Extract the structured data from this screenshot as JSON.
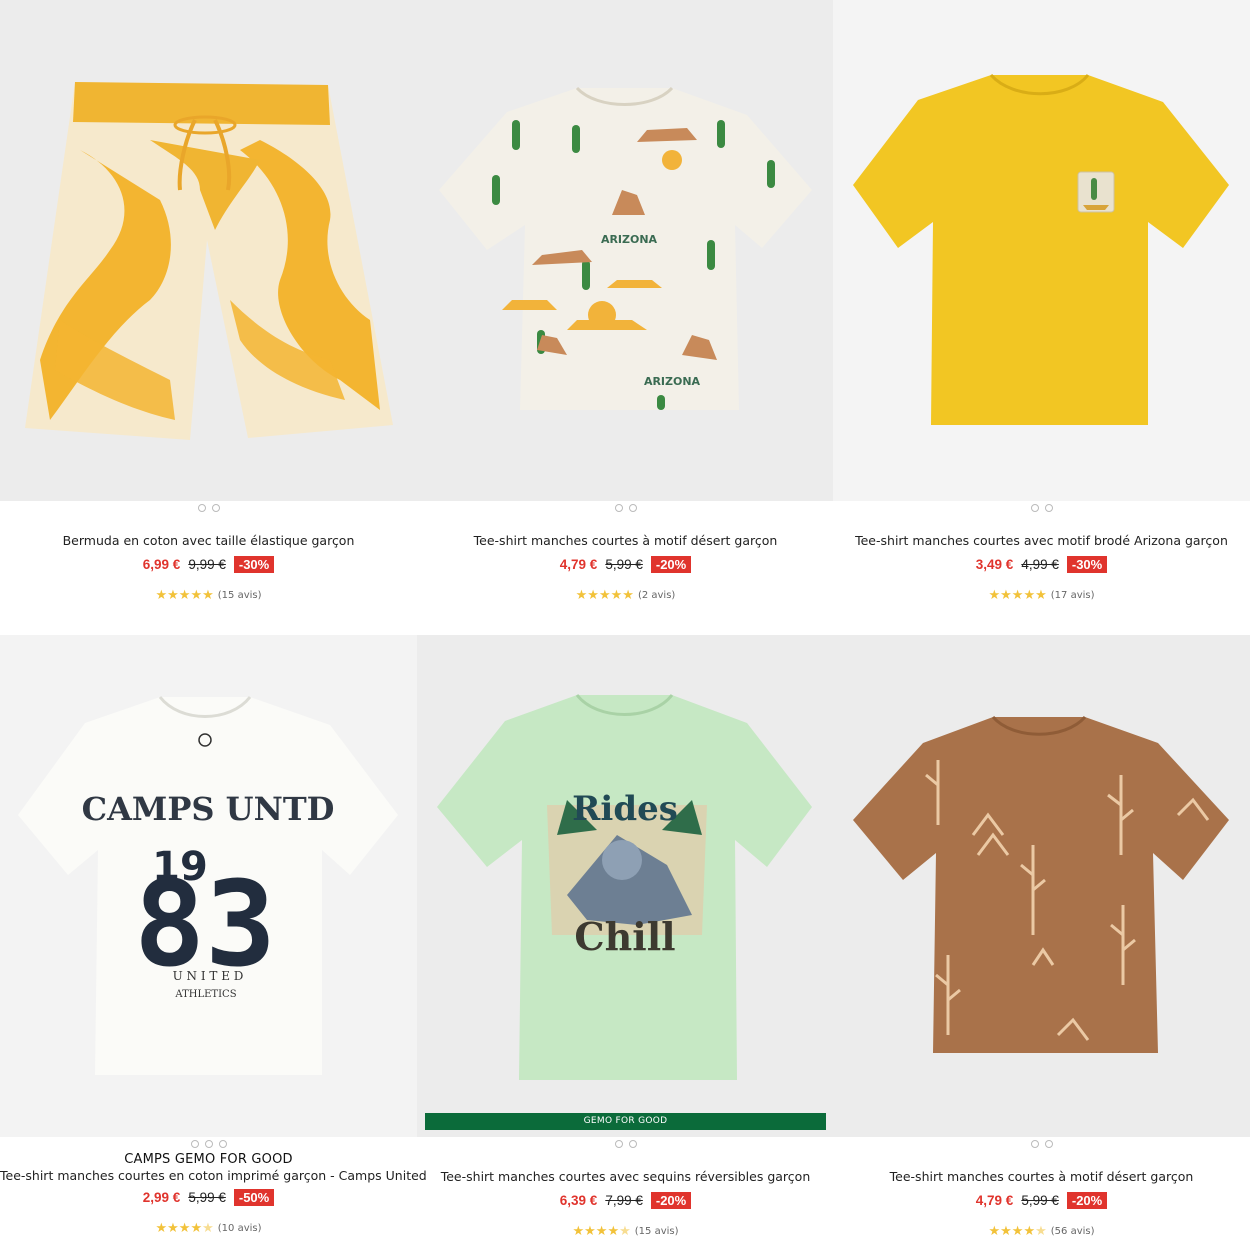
{
  "products": [
    {
      "brand": "",
      "title": "Bermuda en coton avec taille élastique garçon",
      "price": "6,99 €",
      "old_price": "9,99 €",
      "discount": "-30%",
      "rating": 5,
      "reviews": "(15 avis)",
      "image": "yellow-tie-dye-shorts",
      "bg": "#ececec"
    },
    {
      "brand": "",
      "title": "Tee-shirt manches courtes à motif désert garçon",
      "price": "4,79 €",
      "old_price": "5,99 €",
      "discount": "-20%",
      "rating": 5,
      "reviews": "(2 avis)",
      "image": "arizona-desert-print-tshirt",
      "bg": "#ececec"
    },
    {
      "brand": "",
      "title": "Tee-shirt manches courtes avec motif brodé Arizona garçon",
      "price": "3,49 €",
      "old_price": "4,99 €",
      "discount": "-30%",
      "rating": 5,
      "reviews": "(17 avis)",
      "image": "yellow-tshirt-pocket-patch",
      "bg": "#f4f4f4"
    },
    {
      "brand": "CAMPS GEMO FOR GOOD",
      "title": "Tee-shirt manches courtes en coton imprimé garçon - Camps United",
      "price": "2,99 €",
      "old_price": "5,99 €",
      "discount": "-50%",
      "rating": 4.5,
      "reviews": "(10 avis)",
      "image": "white-camps-united-83-tshirt",
      "bg": "#f3f3f3"
    },
    {
      "brand": "",
      "title": "Tee-shirt manches courtes avec sequins réversibles garçon",
      "price": "6,39 €",
      "old_price": "7,99 €",
      "discount": "-20%",
      "rating": 4.5,
      "reviews": "(15 avis)",
      "image": "green-rides-chill-shark-tshirt",
      "bg": "#ececec",
      "banner": "GEMO FOR GOOD"
    },
    {
      "brand": "",
      "title": "Tee-shirt manches courtes à motif désert garçon",
      "price": "4,79 €",
      "old_price": "5,99 €",
      "discount": "-20%",
      "rating": 4.5,
      "reviews": "(56 avis)",
      "image": "brown-cactus-print-tshirt",
      "bg": "#ececec"
    }
  ],
  "print_text": {
    "arizona": "ARIZONA",
    "camps": "CAMPS UNTD",
    "nineteen": "19",
    "eightythree": "83",
    "united": "U N I T E D",
    "athletics": "ATHLETICS",
    "rides": "Rides",
    "chill": "Chill"
  },
  "colors": {
    "price_red": "#e0342d",
    "star_yellow": "#f2c23a",
    "banner_green": "#0b6b3a"
  }
}
